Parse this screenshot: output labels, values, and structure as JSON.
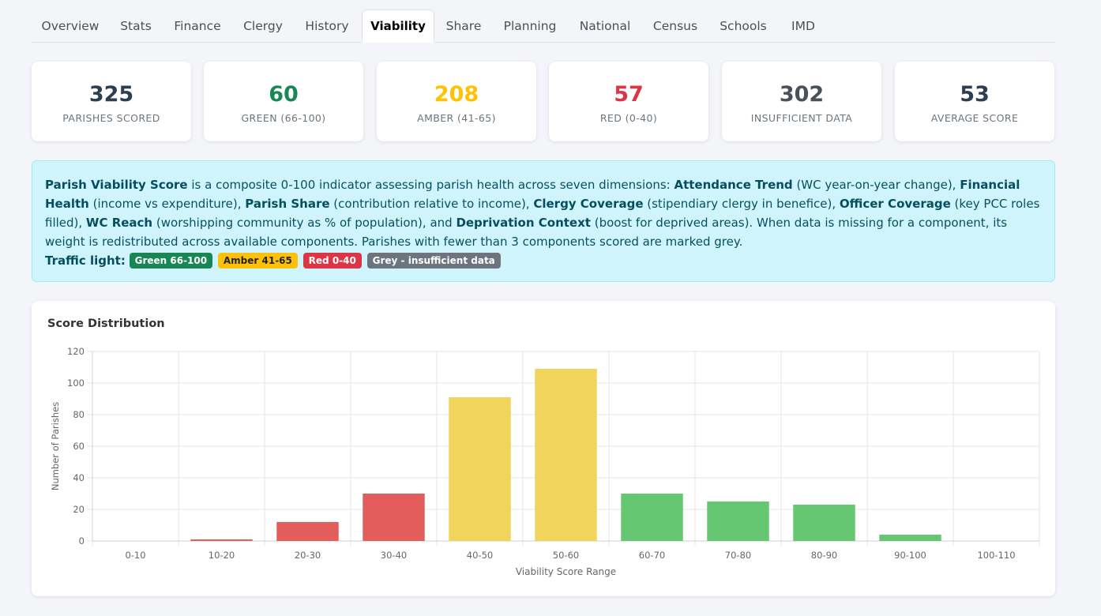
{
  "tabs": [
    {
      "label": "Overview"
    },
    {
      "label": "Stats"
    },
    {
      "label": "Finance"
    },
    {
      "label": "Clergy"
    },
    {
      "label": "History"
    },
    {
      "label": "Viability",
      "active": true
    },
    {
      "label": "Share"
    },
    {
      "label": "Planning"
    },
    {
      "label": "National"
    },
    {
      "label": "Census"
    },
    {
      "label": "Schools"
    },
    {
      "label": "IMD"
    }
  ],
  "stats": [
    {
      "value": "325",
      "label": "Parishes Scored",
      "color": "#2c3e50"
    },
    {
      "value": "60",
      "label": "Green (66-100)",
      "color": "#198754"
    },
    {
      "value": "208",
      "label": "Amber (41-65)",
      "color": "#ffc107"
    },
    {
      "value": "57",
      "label": "Red (0-40)",
      "color": "#dc3545"
    },
    {
      "value": "302",
      "label": "Insufficient Data",
      "color": "#495057"
    },
    {
      "value": "53",
      "label": "Average Score",
      "color": "#2c3e50"
    }
  ],
  "info": {
    "title": "Parish Viability Score",
    "t1": " is a composite 0-100 indicator assessing parish health across seven dimensions: ",
    "d1": "Attendance Trend",
    "t2": " (WC year-on-year change), ",
    "d2": "Financial Health",
    "t3": " (income vs expenditure), ",
    "d3": "Parish Share",
    "t4": " (contribution relative to income), ",
    "d4": "Clergy Coverage",
    "t5": " (stipendiary clergy in benefice), ",
    "d5": "Officer Coverage",
    "t6": " (key PCC roles filled), ",
    "d6": "WC Reach",
    "t7": " (worshipping community as % of population), and ",
    "d7": "Deprivation Context",
    "t8": " (boost for deprived areas). When data is missing for a component, its weight is redistributed across available components. Parishes with fewer than 3 components scored are marked grey.",
    "traffic_label": "Traffic light:",
    "badges": [
      {
        "label": "Green 66-100",
        "color": "#198754"
      },
      {
        "label": "Amber 41-65",
        "color": "#ffc107"
      },
      {
        "label": "Red 0-40",
        "color": "#dc3545"
      },
      {
        "label": "Grey - insufficient data",
        "color": "#6c757d"
      }
    ]
  },
  "chart_title": "Score Distribution",
  "chart_data": {
    "type": "bar",
    "title": "Score Distribution",
    "categories": [
      "0-10",
      "10-20",
      "20-30",
      "30-40",
      "40-50",
      "50-60",
      "60-70",
      "70-80",
      "80-90",
      "90-100",
      "100-110"
    ],
    "values": [
      0,
      1,
      12,
      30,
      91,
      109,
      30,
      25,
      23,
      4,
      0
    ],
    "colors": [
      "#e35d5d",
      "#e35d5d",
      "#e35d5d",
      "#e35d5d",
      "#f0d45c",
      "#f0d45c",
      "#66c772",
      "#66c772",
      "#66c772",
      "#66c772",
      "#66c772"
    ],
    "xlabel": "Viability Score Range",
    "ylabel": "Number of Parishes",
    "ylim": [
      0,
      120
    ],
    "yticks": [
      "0",
      "20",
      "40",
      "60",
      "80",
      "100",
      "120"
    ],
    "grid": true,
    "legend": "none"
  }
}
